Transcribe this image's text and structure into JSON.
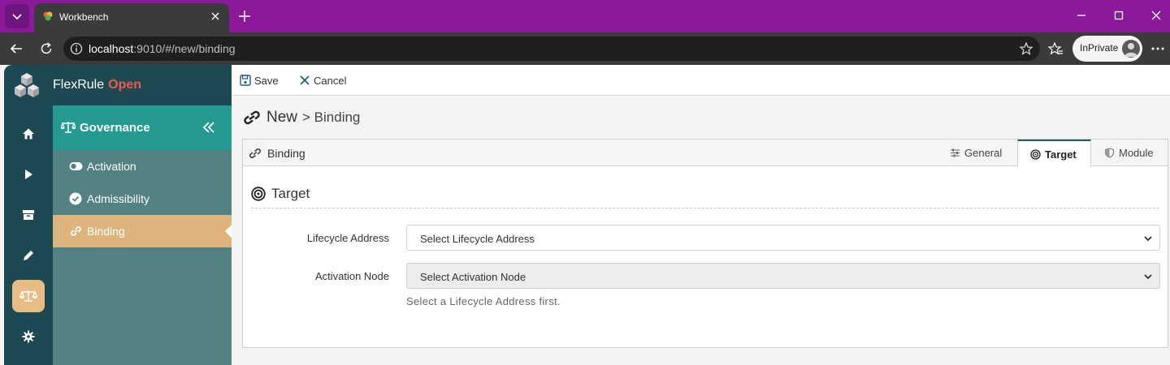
{
  "browser": {
    "tab_title": "Workbench",
    "url_host": "localhost",
    "url_rest": ":9010/#/new/binding",
    "inprivate_label": "InPrivate"
  },
  "app": {
    "brand_name": "FlexRule",
    "brand_accent": "Open",
    "brand_accent_color": "#ef5a4c"
  },
  "rail": {
    "items": [
      {
        "icon": "home-icon"
      },
      {
        "icon": "play-icon"
      },
      {
        "icon": "archive-icon"
      },
      {
        "icon": "pencil-icon"
      },
      {
        "icon": "scale-icon",
        "active": true
      },
      {
        "icon": "gear-icon"
      }
    ],
    "active_color": "#e7bd83"
  },
  "submenu": {
    "title": "Governance",
    "items": [
      {
        "label": "Activation",
        "icon": "toggle-icon"
      },
      {
        "label": "Admissibility",
        "icon": "check-circle-icon"
      },
      {
        "label": "Binding",
        "icon": "link-icon",
        "active": true
      }
    ]
  },
  "toolbar": {
    "save_label": "Save",
    "cancel_label": "Cancel"
  },
  "page": {
    "title": "New",
    "title_sub": "> Binding"
  },
  "panel": {
    "head_label": "Binding",
    "tabs": [
      {
        "label": "General",
        "icon": "sliders-icon"
      },
      {
        "label": "Target",
        "icon": "target-icon",
        "active": true
      },
      {
        "label": "Module",
        "icon": "shield-icon"
      }
    ],
    "section_title": "Target",
    "fields": [
      {
        "label": "Lifecycle Address",
        "placeholder": "Select Lifecycle Address"
      },
      {
        "label": "Activation Node",
        "placeholder": "Select Activation Node",
        "disabled": true
      }
    ],
    "help_text": "Select a Lifecycle Address first."
  }
}
